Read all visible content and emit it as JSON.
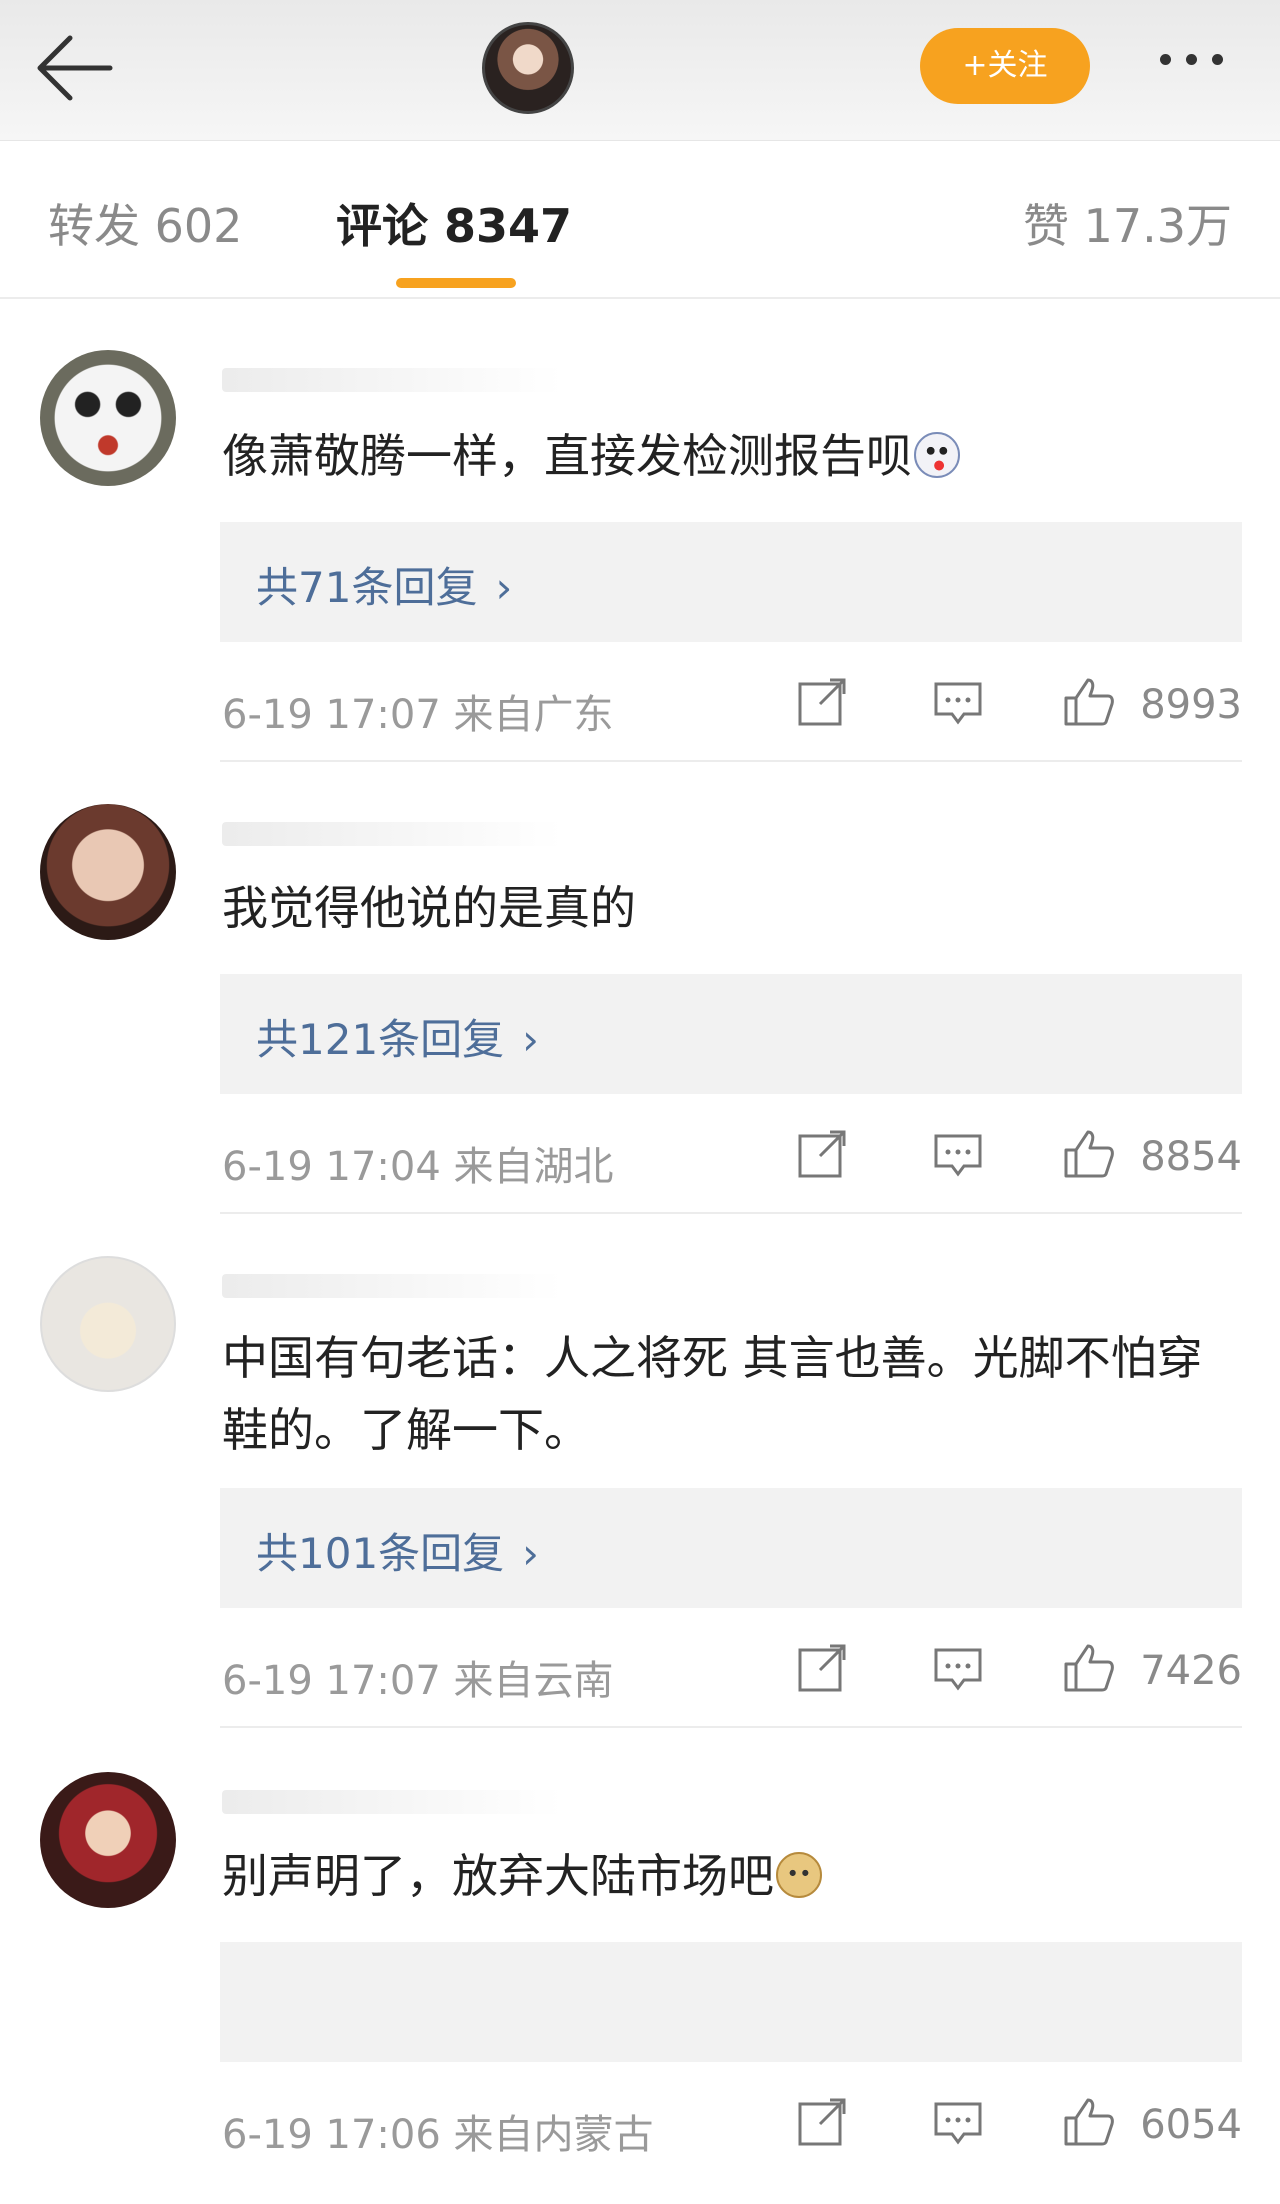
{
  "header": {
    "back_icon": "arrow-left-icon",
    "follow_label": "+关注",
    "more_icon": "more-dots-icon",
    "accent_color": "#f7a21f"
  },
  "tabs": {
    "forward": "转发 602",
    "comment": "评论 8347",
    "like": "赞 17.3万"
  },
  "comments": [
    {
      "text": "像萧敬腾一样，直接发检测报告呗",
      "emoji": "face-emoji-icon",
      "replies": "共71条回复",
      "time": "6-19 17:07",
      "location": "来自广东",
      "likes": "8993"
    },
    {
      "text": "我觉得他说的是真的",
      "replies": "共121条回复",
      "time": "6-19 17:04",
      "location": "来自湖北",
      "likes": "8854"
    },
    {
      "text": "中国有句老话：人之将死 其言也善。光脚不怕穿鞋的。了解一下。",
      "replies": "共101条回复",
      "time": "6-19 17:07",
      "location": "来自云南",
      "likes": "7426"
    },
    {
      "text": "别声明了，放弃大陆市场吧",
      "emoji": "doge-emoji-icon",
      "replies": "",
      "time": "6-19 17:06",
      "location": "来自内蒙古",
      "likes": "6054"
    }
  ]
}
